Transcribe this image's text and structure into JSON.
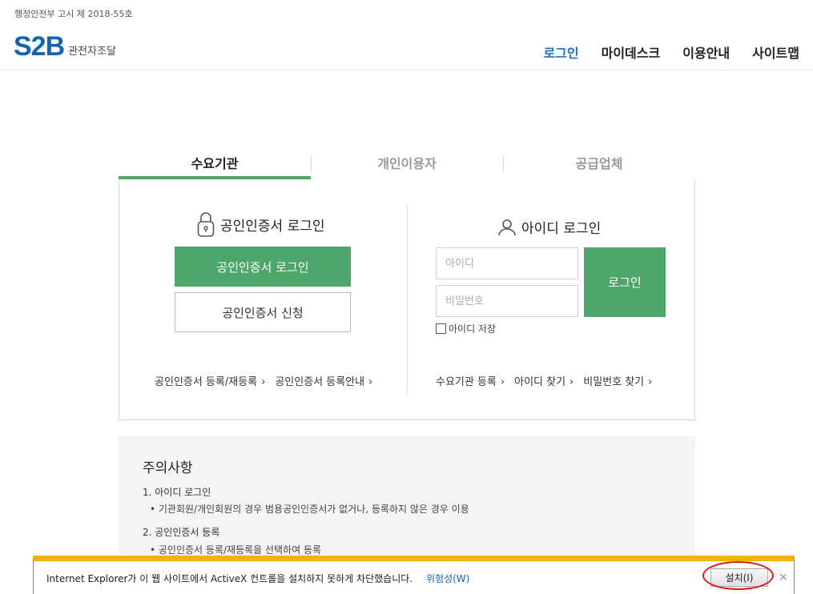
{
  "header": {
    "notice": "행정안전부 고시 제 2018-55호",
    "logo_mark": "S2B",
    "logo_sub": "관전자조달",
    "nav": [
      {
        "label": "로그인"
      },
      {
        "label": "마이데스크"
      },
      {
        "label": "이용안내"
      },
      {
        "label": "사이트맵"
      }
    ]
  },
  "tabs": [
    {
      "label": "수요기관"
    },
    {
      "label": "개인이용자"
    },
    {
      "label": "공급업체"
    }
  ],
  "cert_login": {
    "title": "공인인증서 로그인",
    "login_button": "공인인증서 로그인",
    "apply_button": "공인인증서 신청",
    "links": [
      "공인인증서 등록/재등록",
      "공인인증서 등록안내"
    ]
  },
  "id_login": {
    "title": "아이디 로그인",
    "id_placeholder": "아이디",
    "pw_placeholder": "비밀번호",
    "login_button": "로그인",
    "save_id_label": "아이디 저장",
    "links": [
      "수요기관 등록",
      "아이디 찾기",
      "비밀번호 찾기"
    ]
  },
  "notice": {
    "title": "주의사항",
    "items": [
      {
        "heading": "1. 아이디 로그인",
        "sub": "• 기관회원/개인회원의 경우 범용공인인증서가 없거나, 등록하지 않은 경우 이용"
      },
      {
        "heading": "2. 공인인증서 등록",
        "sub": "• 공인인증서 등록/재등록을 선택하여 등록"
      }
    ]
  },
  "ie_bar": {
    "message": "Internet Explorer가 이 웹 사이트에서 ActiveX 컨트롤을 설치하지 못하게 차단했습니다.",
    "risk_link": "위험성(W)",
    "install_button": "설치(I)",
    "close": "×"
  },
  "colors": {
    "accent_green": "#4da66a",
    "brand_blue": "#1464b4",
    "warning_yellow": "#f0b400",
    "highlight_red": "#e01515"
  }
}
